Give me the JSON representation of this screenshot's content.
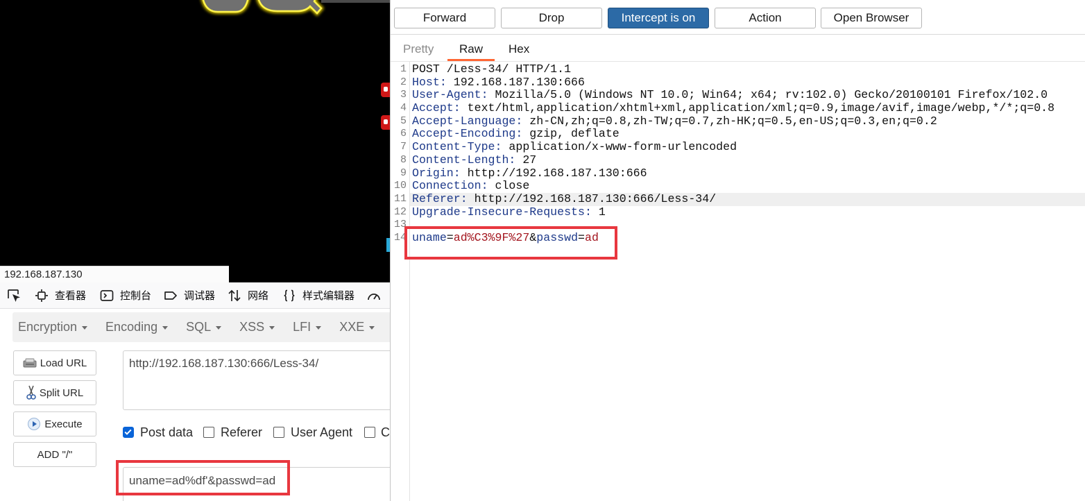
{
  "left_page": {
    "status_url": "192.168.187.130"
  },
  "devtools": {
    "tabs": [
      {
        "label": "查看器",
        "icon": "inspector-icon"
      },
      {
        "label": "控制台",
        "icon": "console-icon"
      },
      {
        "label": "调试器",
        "icon": "debugger-icon"
      },
      {
        "label": "网络",
        "icon": "network-icon"
      },
      {
        "label": "样式编辑器",
        "icon": "style-editor-icon"
      }
    ]
  },
  "hackbar": {
    "menus": [
      {
        "label": "Encryption"
      },
      {
        "label": "Encoding"
      },
      {
        "label": "SQL"
      },
      {
        "label": "XSS"
      },
      {
        "label": "LFI"
      },
      {
        "label": "XXE"
      }
    ],
    "buttons": [
      {
        "label": "Load URL",
        "icon": "load-url-icon"
      },
      {
        "label": "Split URL",
        "icon": "scissors-icon"
      },
      {
        "label": "Execute",
        "icon": "play-icon"
      },
      {
        "label": "ADD \"/\""
      }
    ],
    "url": "http://192.168.187.130:666/Less-34/",
    "options": [
      {
        "label": "Post data",
        "checked": true
      },
      {
        "label": "Referer",
        "checked": false
      },
      {
        "label": "User Agent",
        "checked": false
      },
      {
        "label": "C",
        "checked": false
      }
    ],
    "post_data": "uname=ad%df'&passwd=ad"
  },
  "burp": {
    "actions": [
      {
        "label": "Forward"
      },
      {
        "label": "Drop"
      },
      {
        "label": "Intercept is on",
        "active": true
      },
      {
        "label": "Action"
      },
      {
        "label": "Open Browser"
      }
    ],
    "view_tabs": [
      {
        "label": "Pretty",
        "active": false
      },
      {
        "label": "Raw",
        "active": true
      },
      {
        "label": "Hex",
        "active": false
      }
    ],
    "request": [
      {
        "num": "1",
        "value": "POST /Less-34/ HTTP/1.1"
      },
      {
        "num": "2",
        "key": "Host:",
        "value": " 192.168.187.130:666"
      },
      {
        "num": "3",
        "key": "User-Agent:",
        "value": " Mozilla/5.0 (Windows NT 10.0; Win64; x64; rv:102.0) Gecko/20100101 Firefox/102.0"
      },
      {
        "num": "4",
        "key": "Accept:",
        "value": " text/html,application/xhtml+xml,application/xml;q=0.9,image/avif,image/webp,*/*;q=0.8"
      },
      {
        "num": "5",
        "key": "Accept-Language:",
        "value": " zh-CN,zh;q=0.8,zh-TW;q=0.7,zh-HK;q=0.5,en-US;q=0.3,en;q=0.2"
      },
      {
        "num": "6",
        "key": "Accept-Encoding:",
        "value": " gzip, deflate"
      },
      {
        "num": "7",
        "key": "Content-Type:",
        "value": " application/x-www-form-urlencoded"
      },
      {
        "num": "8",
        "key": "Content-Length:",
        "value": " 27"
      },
      {
        "num": "9",
        "key": "Origin:",
        "value": " http://192.168.187.130:666"
      },
      {
        "num": "10",
        "key": "Connection:",
        "value": " close"
      },
      {
        "num": "11",
        "key": "Referer:",
        "value": " http://192.168.187.130:666/Less-34/"
      },
      {
        "num": "12",
        "key": "Upgrade-Insecure-Requests:",
        "value": " 1"
      },
      {
        "num": "13"
      },
      {
        "num": "14",
        "segments": [
          {
            "text": "uname"
          },
          {
            "text": "="
          },
          {
            "text": "ad%C3%9F%27"
          },
          {
            "text": "&"
          },
          {
            "text": "passwd"
          },
          {
            "text": "="
          },
          {
            "text": "ad"
          }
        ]
      }
    ]
  },
  "colors": {
    "header_key": "#1e3a8a",
    "body_param": "#1e3a8a",
    "body_value": "#a3151e",
    "intercept_on": "#2c6aa6",
    "raw_tab_underline": "#ff6633",
    "annotation_red": "#e8373f",
    "checkbox_blue": "#0a64d8"
  }
}
